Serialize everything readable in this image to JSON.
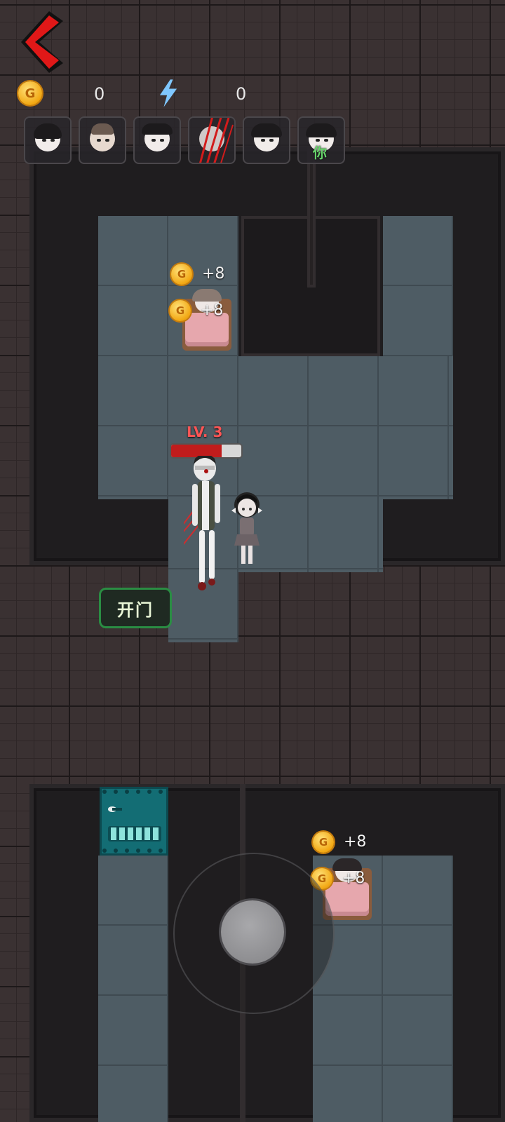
{
  "hud": {
    "coin_symbol": "G",
    "coins": "0",
    "energy": "0",
    "energy_color": "#7fc7ff"
  },
  "roster": {
    "you_label": "你"
  },
  "rewards": [
    {
      "symbol": "G",
      "text": "+8"
    },
    {
      "symbol": "G",
      "text": "+8"
    },
    {
      "symbol": "G",
      "text": "+8"
    },
    {
      "symbol": "G",
      "text": "+8"
    }
  ],
  "monster": {
    "level_label": "LV. 3",
    "hp_fraction": 0.72
  },
  "buttons": {
    "open_door": "开门"
  },
  "colors": {
    "accent_red": "#e01818",
    "button_green": "#2a8d43",
    "coin_gold": "#f2a712",
    "door_teal": "#136d74"
  }
}
